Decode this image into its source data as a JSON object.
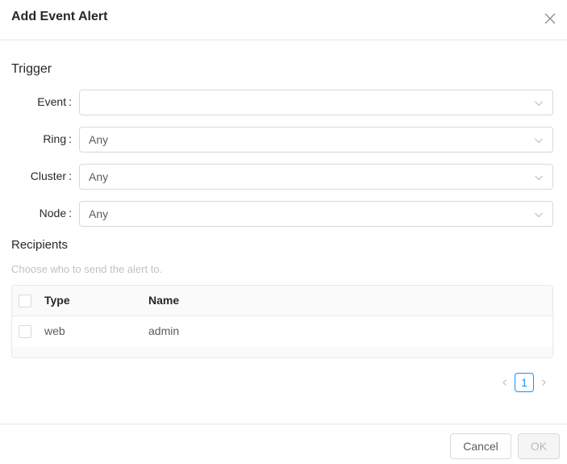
{
  "dialog": {
    "title": "Add Event Alert",
    "close_icon": "close-icon"
  },
  "trigger": {
    "section_title": "Trigger",
    "fields": [
      {
        "label": "Event",
        "value": ""
      },
      {
        "label": "Ring",
        "value": "Any"
      },
      {
        "label": "Cluster",
        "value": "Any"
      },
      {
        "label": "Node",
        "value": "Any"
      }
    ],
    "colon": ":"
  },
  "recipients": {
    "section_title": "Recipients",
    "hint": "Choose who to send the alert to.",
    "columns": [
      "Type",
      "Name"
    ],
    "rows": [
      {
        "type": "web",
        "name": "admin"
      }
    ]
  },
  "pagination": {
    "current_page": "1"
  },
  "footer": {
    "cancel_label": "Cancel",
    "ok_label": "OK"
  },
  "colors": {
    "accent": "#1890ff",
    "border": "#d9d9d9",
    "disabled_bg": "#f5f5f5"
  }
}
